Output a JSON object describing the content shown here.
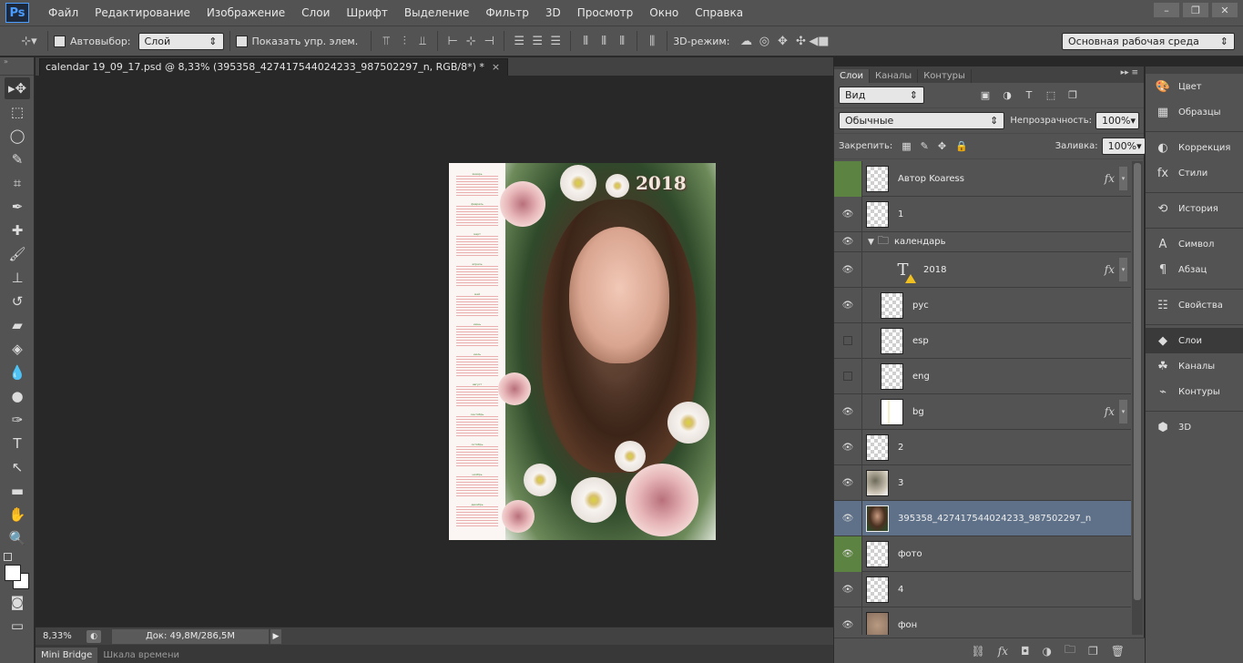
{
  "app": {
    "logo": "Ps",
    "menu": [
      "Файл",
      "Редактирование",
      "Изображение",
      "Слои",
      "Шрифт",
      "Выделение",
      "Фильтр",
      "3D",
      "Просмотр",
      "Окно",
      "Справка"
    ],
    "window_controls": [
      "minimize-icon",
      "restore-icon",
      "close-icon"
    ]
  },
  "options_bar": {
    "autoselect_label": "Автовыбор:",
    "autoselect_value": "Слой",
    "show_transform_label": "Показать упр. элем.",
    "mode_3d_label": "3D-режим:",
    "workspace_value": "Основная рабочая среда"
  },
  "document": {
    "tab_title": "calendar 19_09_17.psd @ 8,33% (395358_427417544024233_987502297_n, RGB/8*) *",
    "close_glyph": "×",
    "year_text": "2018",
    "months": [
      "январь",
      "февраль",
      "март",
      "апрель",
      "май",
      "июнь",
      "июль",
      "август",
      "сентябрь",
      "октябрь",
      "ноябрь",
      "декабрь"
    ]
  },
  "status": {
    "zoom": "8,33%",
    "doc_info": "Док: 49,8M/286,5M"
  },
  "bottom_tabs": [
    "Mini Bridge",
    "Шкала времени"
  ],
  "layers_panel": {
    "tabs": [
      "Слои",
      "Каналы",
      "Контуры"
    ],
    "filter_label": "Вид",
    "blend_mode": "Обычные",
    "opacity_label": "Непрозрачность:",
    "opacity_value": "100%",
    "lock_label": "Закрепить:",
    "fill_label": "Заливка:",
    "fill_value": "100%",
    "layers": [
      {
        "name": "Автор Koaress",
        "visible": false,
        "green": true,
        "fx": true,
        "kind": "normal"
      },
      {
        "name": "1",
        "visible": true,
        "fx": false,
        "kind": "normal"
      },
      {
        "name": "календарь",
        "visible": true,
        "fx": false,
        "kind": "group"
      },
      {
        "name": "2018",
        "visible": true,
        "fx": true,
        "kind": "text"
      },
      {
        "name": "рус",
        "visible": true,
        "fx": false,
        "kind": "child"
      },
      {
        "name": "esp",
        "visible": false,
        "fx": false,
        "kind": "child"
      },
      {
        "name": "eng",
        "visible": false,
        "fx": false,
        "kind": "child"
      },
      {
        "name": "bg",
        "visible": true,
        "fx": true,
        "kind": "child"
      },
      {
        "name": "2",
        "visible": true,
        "fx": false,
        "kind": "normal"
      },
      {
        "name": "3",
        "visible": true,
        "fx": false,
        "kind": "normal"
      },
      {
        "name": "395358_427417544024233_987502297_n",
        "visible": true,
        "fx": false,
        "kind": "photo",
        "selected": true
      },
      {
        "name": "фото",
        "visible": true,
        "green": true,
        "fx": false,
        "kind": "normal"
      },
      {
        "name": "4",
        "visible": true,
        "fx": false,
        "kind": "normal"
      },
      {
        "name": "фон",
        "visible": true,
        "fx": false,
        "kind": "normal"
      }
    ]
  },
  "dock": {
    "items": [
      {
        "label": "Цвет",
        "icon": "palette-icon"
      },
      {
        "label": "Образцы",
        "icon": "swatches-icon"
      },
      {
        "label": "Коррекция",
        "icon": "adjustments-icon"
      },
      {
        "label": "Стили",
        "icon": "styles-icon"
      },
      {
        "label": "История",
        "icon": "history-icon"
      },
      {
        "label": "Символ",
        "icon": "character-icon"
      },
      {
        "label": "Абзац",
        "icon": "paragraph-icon"
      },
      {
        "label": "Свойства",
        "icon": "properties-icon"
      },
      {
        "label": "Слои",
        "icon": "layers-icon",
        "active": true
      },
      {
        "label": "Каналы",
        "icon": "channels-icon"
      },
      {
        "label": "Контуры",
        "icon": "paths-icon"
      },
      {
        "label": "3D",
        "icon": "3d-icon"
      }
    ]
  },
  "colors": {
    "ui_bg": "#535353",
    "canvas_bg": "#282828",
    "selected_layer": "#5e7189",
    "visibility_green": "#5d8342",
    "logo_blue": "#4a9cff"
  }
}
